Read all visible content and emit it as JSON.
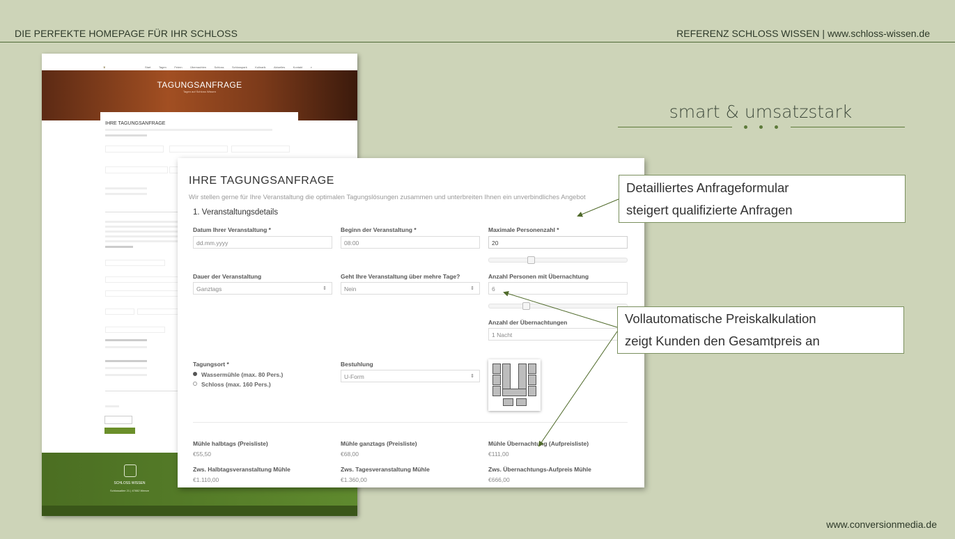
{
  "header": {
    "left": "DIE PERFEKTE HOMEPAGE FÜR IHR SCHLOSS",
    "right_prefix": "REFERENZ SCHLOSS WISSEN | ",
    "right_url": "www.schloss-wissen.de"
  },
  "slogan": "smart & umsatzstark",
  "footer_url": "www.conversionmedia.de",
  "colors": {
    "background": "#cdd4b8",
    "accent_green": "#5d7a3a",
    "button_green": "#6b8f2a"
  },
  "thumbnail": {
    "top_text": "",
    "nav": [
      "Start",
      "Tagen",
      "Feiern",
      "Übernachten",
      "Schloss",
      "Schlosspark",
      "Kulinarik",
      "Aktuelles",
      "Kontakt"
    ],
    "hero_title": "TAGUNGSANFRAGE",
    "hero_subtitle": "Tagen auf Schloss Wissen",
    "form_title": "IHRE TAGUNGSANFRAGE",
    "footer_name": "SCHLOSS WISSEN",
    "footer_address": "Schlossallee 21 | 47652 Weeze"
  },
  "form": {
    "title": "IHRE TAGUNGSANFRAGE",
    "subtitle": "Wir stellen gerne für Ihre Veranstaltung die optimalen Tagungslösungen zusammen und unterbreiten Ihnen ein unverbindliches Angebot",
    "section": "1. Veranstaltungsdetails",
    "date": {
      "label": "Datum Ihrer Veranstaltung *",
      "placeholder": "dd.mm.yyyy"
    },
    "start": {
      "label": "Beginn der Veranstaltung *",
      "value": "08:00"
    },
    "max_persons": {
      "label": "Maximale Personenzahl *",
      "value": "20",
      "slider_fraction": 0.2
    },
    "duration": {
      "label": "Dauer der Veranstaltung",
      "value": "Ganztags"
    },
    "multi_day": {
      "label": "Geht Ihre Veranstaltung über mehre Tage?",
      "value": "Nein"
    },
    "overnight_persons": {
      "label": "Anzahl Personen mit Übernachtung",
      "value": "6",
      "slider_fraction": 0.15
    },
    "nights": {
      "label": "Anzahl der Übernachtungen",
      "value": "1 Nacht"
    },
    "location": {
      "label": "Tagungsort *",
      "options": [
        {
          "text": "Wassermühle (max. 80 Pers.)",
          "selected": true
        },
        {
          "text": "Schloss (max. 160 Pers.)",
          "selected": false
        }
      ]
    },
    "seating": {
      "label": "Bestuhlung",
      "value": "U-Form",
      "icon": "u-form-seating-icon"
    },
    "prices": [
      {
        "label": "Mühle halbtags (Preisliste)",
        "value": "€55,50"
      },
      {
        "label": "Mühle ganztags (Preisliste)",
        "value": "€68,00"
      },
      {
        "label": "Mühle Übernachtung (Aufpreisliste)",
        "value": "€111,00"
      },
      {
        "label": "Zws. Halbtagsveranstaltung Mühle",
        "value": "€1.110,00"
      },
      {
        "label": "Zws. Tagesveranstaltung Mühle",
        "value": "€1.360,00"
      },
      {
        "label": "Zws. Übernachtungs-Aufpreis Mühle",
        "value": "€666,00"
      }
    ]
  },
  "callouts": [
    {
      "line1": "Detailliertes Anfrageformular",
      "line2": "steigert qualifizierte Anfragen"
    },
    {
      "line1": "Vollautomatische Preiskalkulation",
      "line2": "zeigt Kunden den Gesamtpreis an"
    }
  ]
}
